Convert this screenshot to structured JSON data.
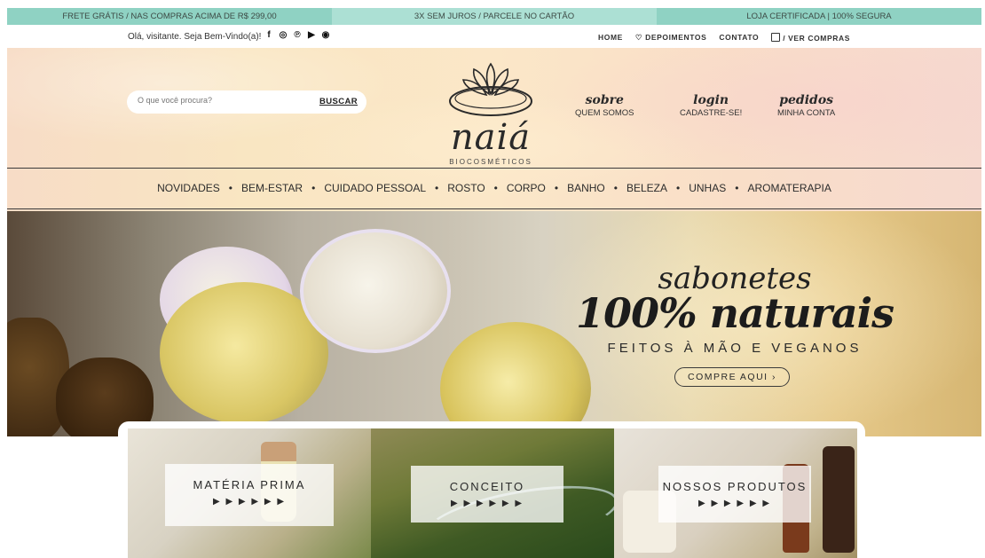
{
  "promo": {
    "left": "FRETE GRÁTIS / NAS COMPRAS ACIMA DE R$ 299,00",
    "center": "3X SEM JUROS / PARCELE NO CARTÃO",
    "right": "LOJA CERTIFICADA | 100% SEGURA"
  },
  "util": {
    "greeting": "Olá, visitante. Seja Bem-Vindo(a)!",
    "socials": [
      "facebook-icon",
      "instagram-icon",
      "pinterest-icon",
      "youtube-icon",
      "spotify-icon"
    ],
    "nav": {
      "home": "HOME",
      "depoimentos": "DEPOIMENTOS",
      "contato": "CONTATO",
      "ver_compras": "/ VER COMPRAS"
    }
  },
  "search": {
    "placeholder": "O que você procura?",
    "button": "BUSCAR"
  },
  "logo": {
    "word": "naiá",
    "subtitle": "BIOCOSMÉTICOS"
  },
  "header_links": [
    {
      "big": "sobre",
      "small": "QUEM SOMOS"
    },
    {
      "big": "login",
      "small": "CADASTRE-SE!"
    },
    {
      "big": "pedidos",
      "small": "MINHA CONTA"
    }
  ],
  "categories": [
    "NOVIDADES",
    "BEM-ESTAR",
    "CUIDADO PESSOAL",
    "ROSTO",
    "CORPO",
    "BANHO",
    "BELEZA",
    "UNHAS",
    "AROMATERAPIA"
  ],
  "hero": {
    "line1": "sabonetes",
    "line2": "100% naturais",
    "line3": "FEITOS À MÃO E VEGANOS",
    "cta": "COMPRE AQUI ›"
  },
  "cards": [
    {
      "title": "MATÉRIA PRIMA",
      "arrows": "▶ ▶ ▶ ▶ ▶ ▶"
    },
    {
      "title": "CONCEITO",
      "arrows": "▶ ▶ ▶ ▶ ▶ ▶"
    },
    {
      "title": "NOSSOS PRODUTOS",
      "arrows": "▶ ▶ ▶ ▶ ▶ ▶"
    }
  ],
  "colors": {
    "promo_bar": "#8fd2c3",
    "promo_center": "#ace0d4",
    "header_wash": "#f9e6c2",
    "text": "#2a2a2a"
  }
}
